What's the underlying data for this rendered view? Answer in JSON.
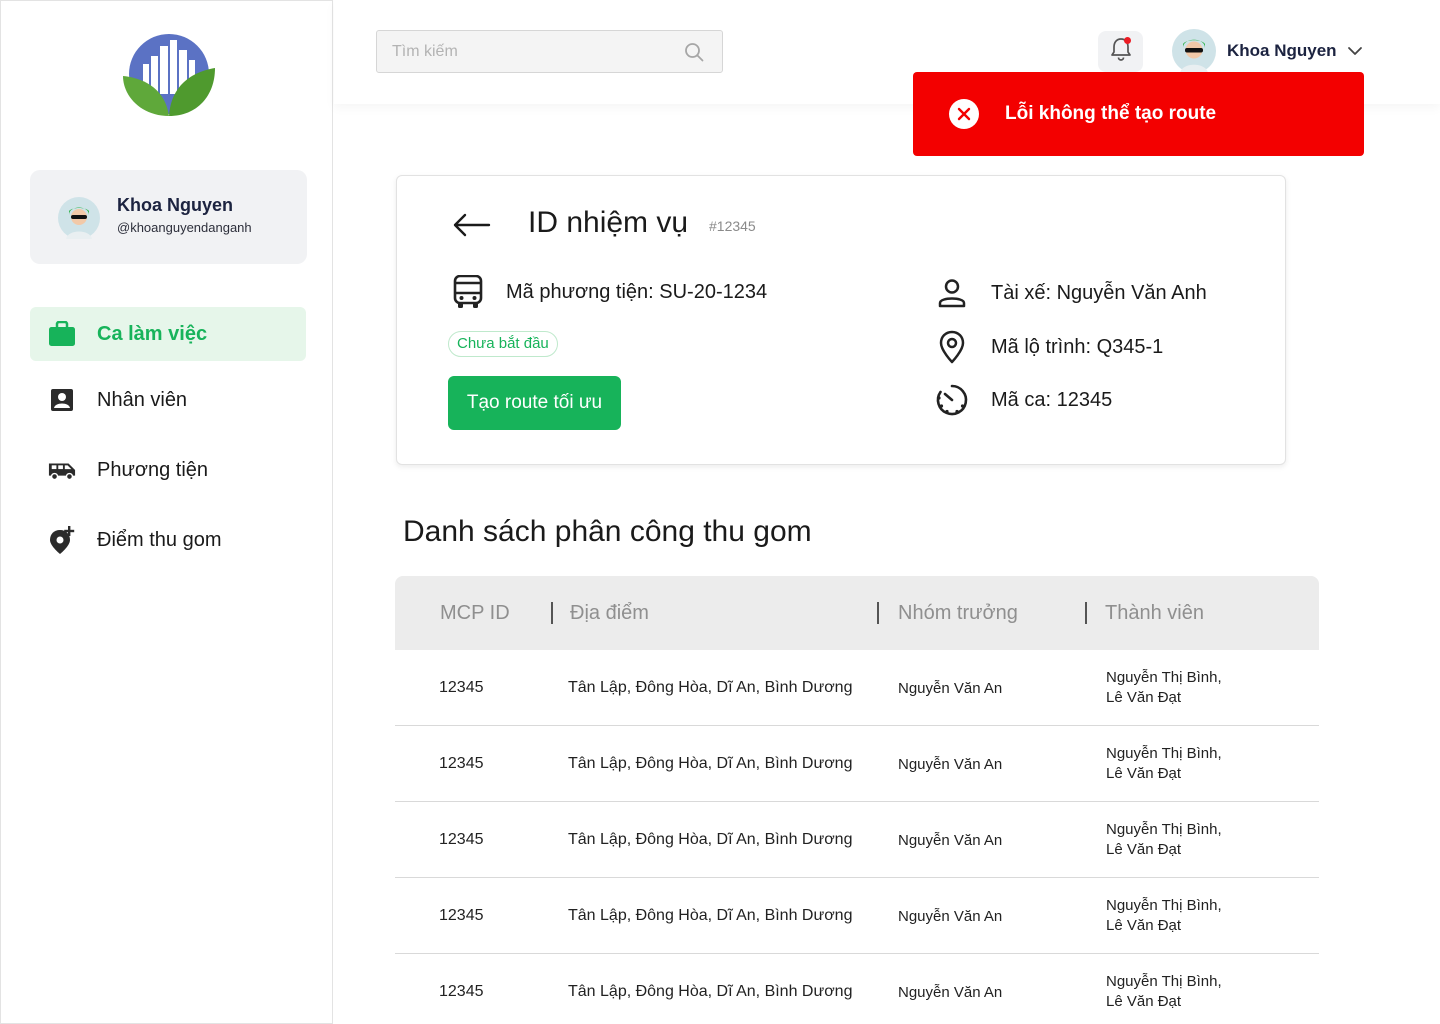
{
  "sidebar": {
    "profile": {
      "name": "Khoa Nguyen",
      "handle": "@khoanguyendanganh"
    },
    "items": [
      {
        "label": "Ca làm việc",
        "icon": "briefcase-icon",
        "active": true
      },
      {
        "label": "Nhân viên",
        "icon": "contact-card-icon",
        "active": false
      },
      {
        "label": "Phương tiện",
        "icon": "van-icon",
        "active": false
      },
      {
        "label": "Điểm thu gom",
        "icon": "add-location-icon",
        "active": false
      }
    ]
  },
  "header": {
    "search_placeholder": "Tìm kiếm",
    "user_name": "Khoa Nguyen",
    "notification_dot": true
  },
  "toast": {
    "message": "Lỗi không thể tạo route",
    "type": "error",
    "color": "#f30000"
  },
  "task": {
    "title": "ID nhiệm vụ",
    "id": "#12345",
    "vehicle": "Mã phương tiện: SU-20-1234",
    "status": "Chưa bắt đầu",
    "action_label": "Tạo route tối ưu",
    "driver": "Tài xế: Nguyễn Văn Anh",
    "route": "Mã lộ trình: Q345-1",
    "shift": "Mã ca: 12345"
  },
  "assignments": {
    "title": "Danh sách phân công thu gom",
    "columns": [
      "MCP ID",
      "Địa điểm",
      "Nhóm trưởng",
      "Thành viên"
    ],
    "rows": [
      {
        "id": "12345",
        "location": "Tân Lập, Đông Hòa, Dĩ An, Bình Dương",
        "leader": "Nguyễn Văn An",
        "members_1": "Nguyễn Thị Bình,",
        "members_2": "Lê Văn Đạt"
      },
      {
        "id": "12345",
        "location": "Tân Lập, Đông Hòa, Dĩ An, Bình Dương",
        "leader": "Nguyễn Văn An",
        "members_1": "Nguyễn Thị Bình,",
        "members_2": "Lê Văn Đạt"
      },
      {
        "id": "12345",
        "location": "Tân Lập, Đông Hòa, Dĩ An, Bình Dương",
        "leader": "Nguyễn Văn An",
        "members_1": "Nguyễn Thị Bình,",
        "members_2": "Lê Văn Đạt"
      },
      {
        "id": "12345",
        "location": "Tân Lập, Đông Hòa, Dĩ An, Bình Dương",
        "leader": "Nguyễn Văn An",
        "members_1": "Nguyễn Thị Bình,",
        "members_2": "Lê Văn Đạt"
      },
      {
        "id": "12345",
        "location": "Tân Lập, Đông Hòa, Dĩ An, Bình Dương",
        "leader": "Nguyễn Văn An",
        "members_1": "Nguyễn Thị Bình,",
        "members_2": "Lê Văn Đạt"
      }
    ]
  },
  "colors": {
    "accent_green": "#17b35a",
    "active_bg": "#e6f6ea",
    "error_red": "#f30000"
  }
}
